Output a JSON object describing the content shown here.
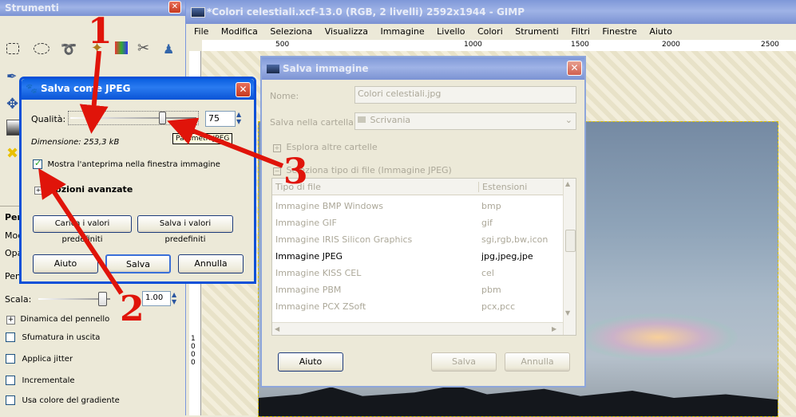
{
  "toolbox": {
    "title": "Strumenti",
    "brush_section_label": "Penn",
    "mode_label": "Mod",
    "opacity_label": "Opa",
    "brush_label": "Penn",
    "scale_label": "Scala:",
    "scale_value": "1.00",
    "dynamics_label": "Dinamica del pennello",
    "options": [
      "Sfumatura in uscita",
      "Applica jitter",
      "Incrementale",
      "Usa colore del gradiente"
    ]
  },
  "gimp_window": {
    "title": "*Colori celestiali.xcf-13.0 (RGB, 2 livelli) 2592x1944 - GIMP",
    "menu": [
      "File",
      "Modifica",
      "Seleziona",
      "Visualizza",
      "Immagine",
      "Livello",
      "Colori",
      "Strumenti",
      "Filtri",
      "Finestre",
      "Aiuto"
    ],
    "ruler_ticks": [
      "500",
      "1000",
      "1500",
      "2000",
      "2500"
    ],
    "vertical_ruler_digits": [
      "1",
      "0",
      "0",
      "0"
    ]
  },
  "jpeg_dialog": {
    "title": "Salva come JPEG",
    "quality_label": "Qualità:",
    "quality_value": "75",
    "quality_fraction": 0.75,
    "tooltip": "Parametri JPEG",
    "size_text": "Dimensione: 253,3 kB",
    "preview_label": "Mostra l'anteprima nella finestra immagine",
    "preview_checked": true,
    "advanced_label": "Opzioni avanzate",
    "load_defaults": "Carica i valori predefiniti",
    "save_defaults": "Salva i valori predefiniti",
    "help": "Aiuto",
    "save": "Salva",
    "cancel": "Annulla"
  },
  "save_dialog": {
    "title": "Salva immagine",
    "name_label": "Nome:",
    "name_value": "Colori celestiali.jpg",
    "folder_label": "Salva nella cartella:",
    "folder_value": "Scrivania",
    "browse_label": "Esplora altre cartelle",
    "filetype_label": "Seleziona tipo di file (Immagine JPEG)",
    "col_type": "Tipo di file",
    "col_ext": "Estensioni",
    "rows": [
      {
        "type": "Immagine BMP Windows",
        "ext": "bmp",
        "active": false
      },
      {
        "type": "Immagine GIF",
        "ext": "gif",
        "active": false
      },
      {
        "type": "Immagine IRIS Silicon Graphics",
        "ext": "sgi,rgb,bw,icon",
        "active": false
      },
      {
        "type": "Immagine JPEG",
        "ext": "jpg,jpeg,jpe",
        "active": true
      },
      {
        "type": "Immagine KISS CEL",
        "ext": "cel",
        "active": false
      },
      {
        "type": "Immagine PBM",
        "ext": "pbm",
        "active": false
      },
      {
        "type": "Immagine PCX ZSoft",
        "ext": "pcx,pcc",
        "active": false
      }
    ],
    "help": "Aiuto",
    "save": "Salva",
    "cancel": "Annulla"
  },
  "annotations": [
    "1",
    "2",
    "3"
  ],
  "colors": {
    "xp_blue": "#0a5fe0",
    "arrow_red": "#e0140a",
    "xp_face": "#ece9d8"
  }
}
